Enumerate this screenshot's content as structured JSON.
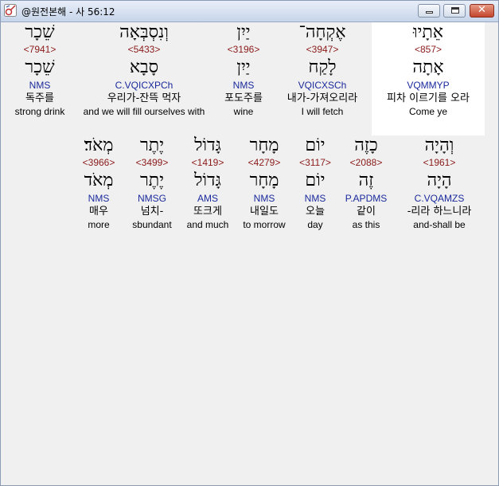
{
  "window": {
    "title": "@원전본해 - 사 56:12",
    "minimize_label": "minimize",
    "maximize_label": "maximize",
    "close_label": "✕"
  },
  "row1": [
    {
      "hebrew": "אֵתָיוּ",
      "strong": "<857>",
      "lemma": "אָתָה",
      "morph": "VQMMYP",
      "korean": "피차 이르기를 오라",
      "english": "Come ye",
      "selected": true
    },
    {
      "hebrew": "אֶקְחָה־",
      "strong": "<3947>",
      "lemma": "לָקַח",
      "morph": "VQICXSCh",
      "korean": "내가-가져오리라",
      "english": "I will fetch",
      "selected": false
    },
    {
      "hebrew": "יַיִן",
      "strong": "<3196>",
      "lemma": "יַיִן",
      "morph": "NMS",
      "korean": "포도주를",
      "english": "wine",
      "selected": false
    },
    {
      "hebrew": "וְנִסְבְּאָה",
      "strong": "<5433>",
      "lemma": "סָבָא",
      "morph": "C.VQICXPCh",
      "korean": "우리가-잔뜩 먹자",
      "english": "and we will fill ourselves with",
      "selected": false
    },
    {
      "hebrew": "שֵׁכָר",
      "strong": "<7941>",
      "lemma": "שֵׁכָר",
      "morph": "NMS",
      "korean": "독주를",
      "english": "strong drink",
      "selected": false
    }
  ],
  "row2": [
    {
      "hebrew": "וְהָיָה",
      "strong": "<1961>",
      "lemma": "הָיָה",
      "morph": "C.VQAMZS",
      "korean": "-리라 하느니라",
      "english": "and-shall be"
    },
    {
      "hebrew": "כָזֶה",
      "strong": "<2088>",
      "lemma": "זֶה",
      "morph": "P.APDMS",
      "korean": "같이",
      "english": "as this"
    },
    {
      "hebrew": "יוֹם",
      "strong": "<3117>",
      "lemma": "יוֹם",
      "morph": "NMS",
      "korean": "오늘",
      "english": "day"
    },
    {
      "hebrew": "מָחָר",
      "strong": "<4279>",
      "lemma": "מָחָר",
      "morph": "NMS",
      "korean": "내일도",
      "english": "to morrow"
    },
    {
      "hebrew": "גָּדוֹל",
      "strong": "<1419>",
      "lemma": "גָּדוֹל",
      "morph": "AMS",
      "korean": "또크게",
      "english": "and much"
    },
    {
      "hebrew": "יֶתֶר",
      "strong": "<3499>",
      "lemma": "יֶתֶר",
      "morph": "NMSG",
      "korean": "넘치-",
      "english": "sbundant"
    },
    {
      "hebrew": "מְאֹד׃",
      "strong": "<3966>",
      "lemma": "מְאֹד",
      "morph": "NMS",
      "korean": "매우",
      "english": "more"
    }
  ]
}
